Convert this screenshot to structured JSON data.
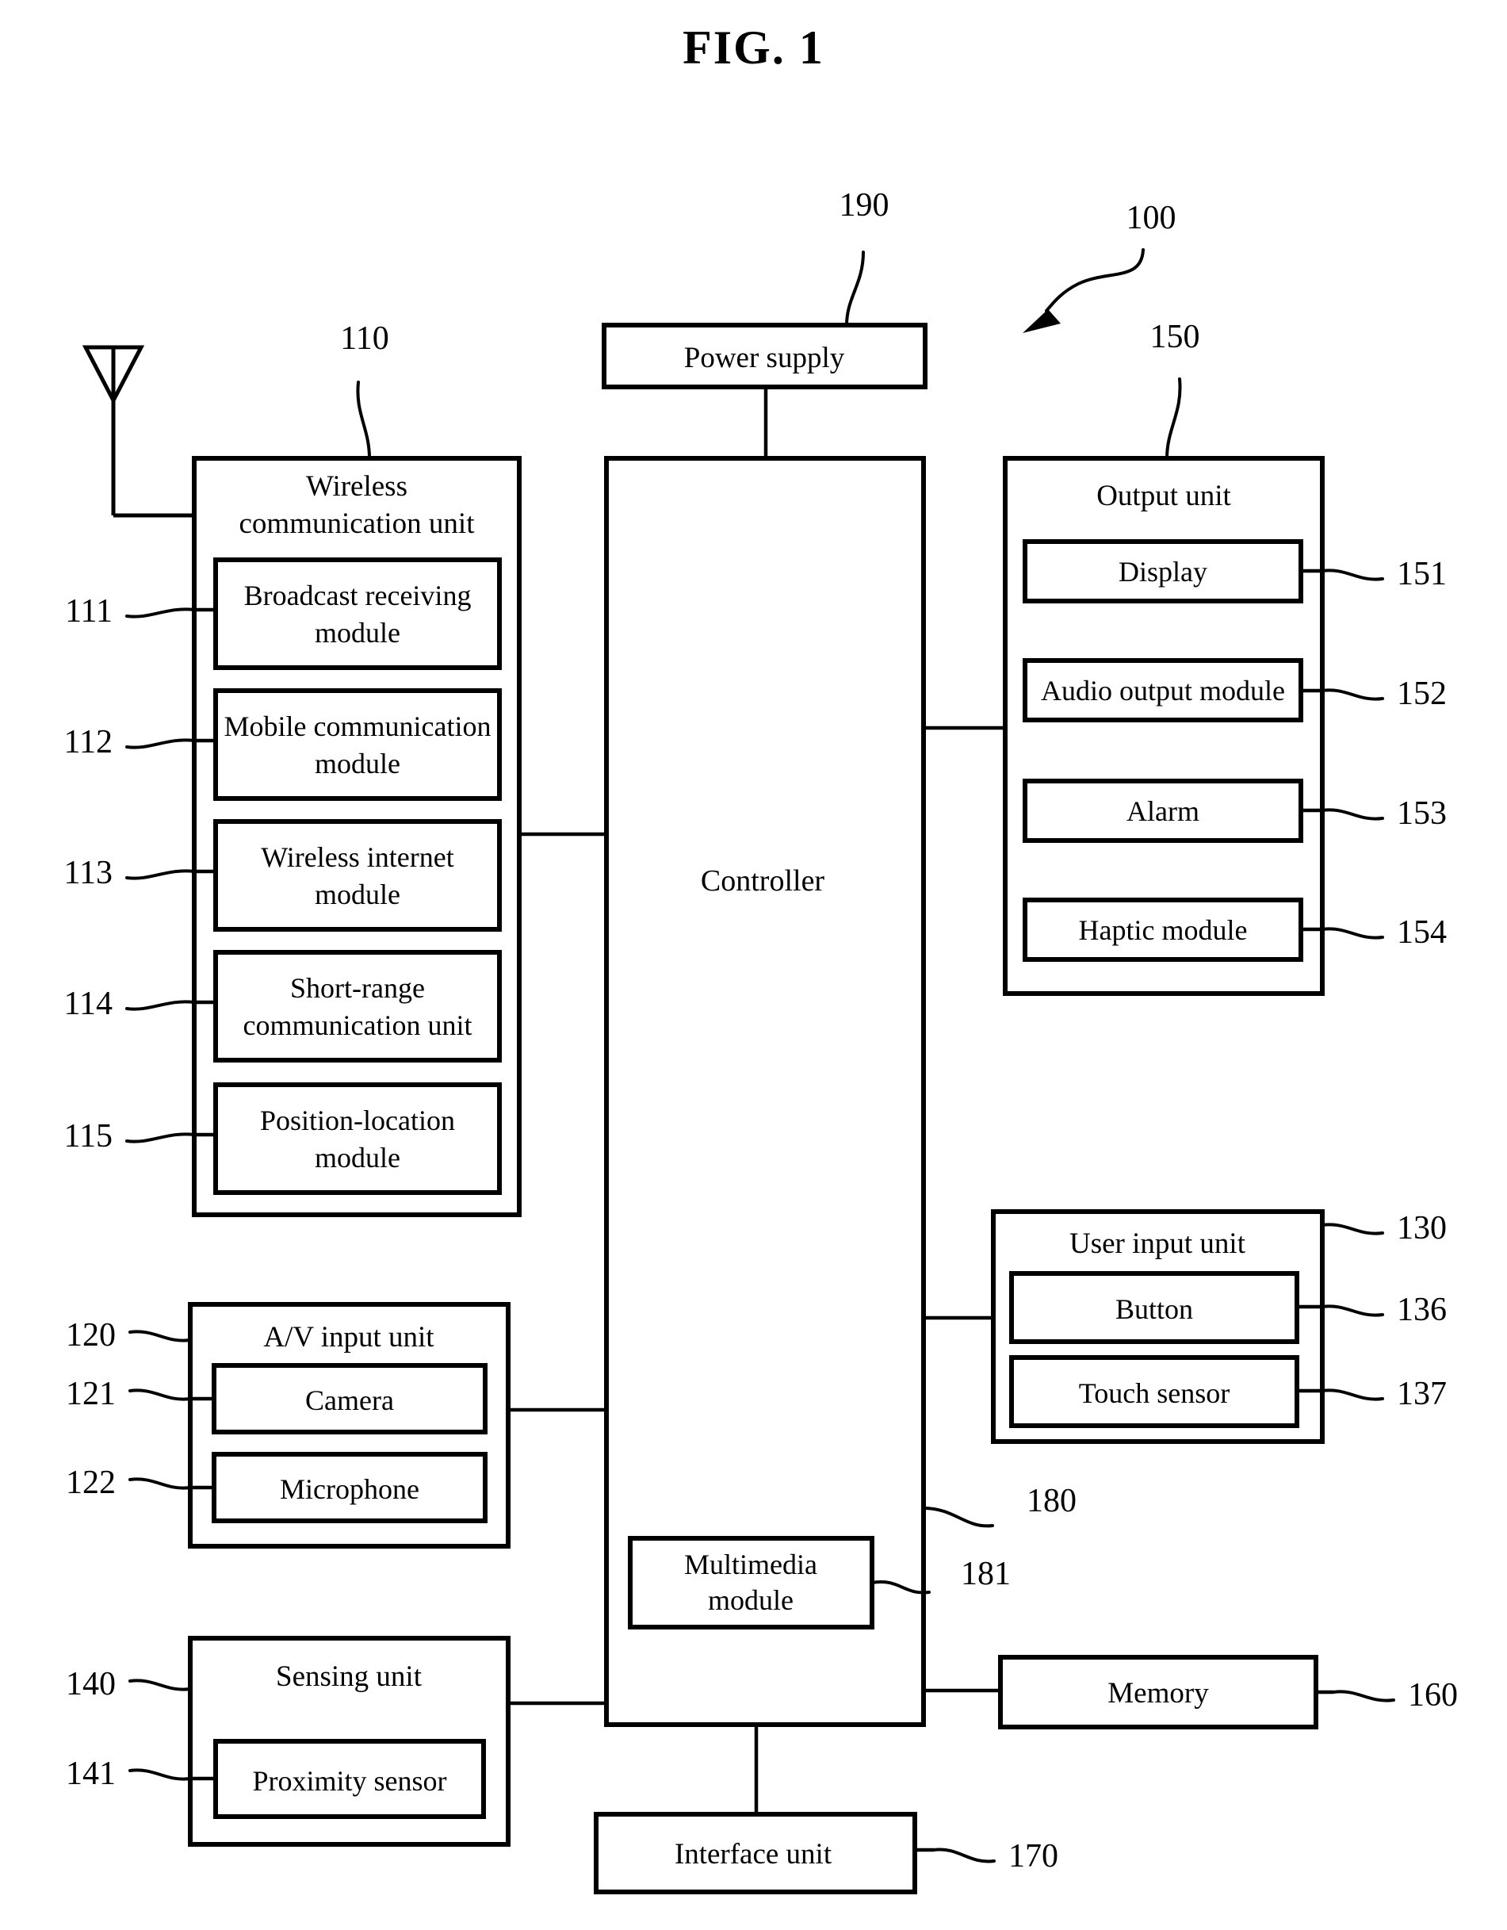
{
  "figure": {
    "title": "FIG. 1",
    "system_ref": "100",
    "system_ref_name": "mobile-terminal"
  },
  "blocks": {
    "power_supply": {
      "label": "Power supply",
      "ref": "190"
    },
    "controller": {
      "label": "Controller",
      "ref": "180"
    },
    "multimedia_module": {
      "label": "Multimedia\nmodule",
      "line1": "Multimedia",
      "line2": "module",
      "ref": "181"
    },
    "interface_unit": {
      "label": "Interface unit",
      "ref": "170"
    },
    "memory": {
      "label": "Memory",
      "ref": "160"
    },
    "wireless_communication_unit": {
      "title_line1": "Wireless",
      "title_line2": "communication unit",
      "ref": "110",
      "modules": [
        {
          "line1": "Broadcast receiving",
          "line2": "module",
          "ref": "111",
          "name": "broadcast-receiving-module"
        },
        {
          "line1": "Mobile communication",
          "line2": "module",
          "ref": "112",
          "name": "mobile-communication-module"
        },
        {
          "line1": "Wireless internet",
          "line2": "module",
          "ref": "113",
          "name": "wireless-internet-module"
        },
        {
          "line1": "Short-range",
          "line2": "communication unit",
          "ref": "114",
          "name": "short-range-communication-unit"
        },
        {
          "line1": "Position-location",
          "line2": "module",
          "ref": "115",
          "name": "position-location-module"
        }
      ]
    },
    "av_input_unit": {
      "title": "A/V input unit",
      "ref": "120",
      "modules": [
        {
          "label": "Camera",
          "ref": "121",
          "name": "camera-module"
        },
        {
          "label": "Microphone",
          "ref": "122",
          "name": "microphone-module"
        }
      ]
    },
    "sensing_unit": {
      "title": "Sensing unit",
      "ref": "140",
      "modules": [
        {
          "label": "Proximity sensor",
          "ref": "141",
          "name": "proximity-sensor-module"
        }
      ]
    },
    "output_unit": {
      "title": "Output unit",
      "ref": "150",
      "modules": [
        {
          "label": "Display",
          "ref": "151",
          "name": "display-module"
        },
        {
          "label": "Audio output module",
          "ref": "152",
          "name": "audio-output-module"
        },
        {
          "label": "Alarm",
          "ref": "153",
          "name": "alarm-module"
        },
        {
          "label": "Haptic module",
          "ref": "154",
          "name": "haptic-module"
        }
      ]
    },
    "user_input_unit": {
      "title": "User input unit",
      "ref": "130",
      "modules": [
        {
          "label": "Button",
          "ref": "136",
          "name": "button-module"
        },
        {
          "label": "Touch sensor",
          "ref": "137",
          "name": "touch-sensor-module"
        }
      ]
    }
  },
  "colors": {
    "ink": "#000000",
    "paper": "#ffffff"
  }
}
